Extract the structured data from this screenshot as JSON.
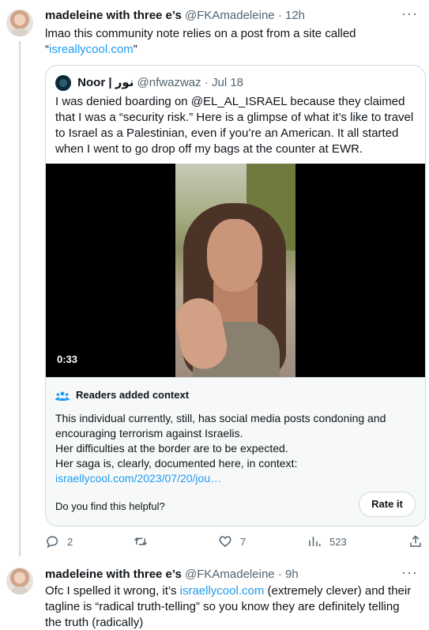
{
  "tweet1": {
    "name": "madeleine with three e’s",
    "handle": "@FKAmadeleine",
    "separator": "·",
    "time": "12h",
    "text_prefix": "lmao this community note relies on a post from a site called “",
    "text_link": "isreallycool.com",
    "text_suffix": "”",
    "quote": {
      "name": "Noor | نور",
      "handle": "@nfwazwaz",
      "separator": "·",
      "date": "Jul 18",
      "text": "I was denied boarding on @EL_AL_ISRAEL because they claimed that I was a “security risk.” Here is a glimpse of what it’s like to travel to Israel as a Palestinian, even if you’re an American. It all started when I went to go drop off my bags at the counter at EWR.",
      "video_duration": "0:33",
      "context": {
        "heading": "Readers added context",
        "line1": "This individual currently, still, has social media posts condoning and encouraging terrorism against Israelis.",
        "line2": "Her difficulties at the border are to be expected.",
        "line3": "Her saga is, clearly, documented here, in context:",
        "link": "israellycool.com/2023/07/20/jou…",
        "helpful_prompt": "Do you find this helpful?",
        "rate_button": "Rate it"
      }
    },
    "actions": {
      "replies": "2",
      "retweets": "",
      "likes": "7",
      "views": "523"
    }
  },
  "tweet2": {
    "name": "madeleine with three e’s",
    "handle": "@FKAmadeleine",
    "separator": "·",
    "time": "9h",
    "text_prefix": "Ofc I spelled it wrong, it’s ",
    "text_link": "israellycool.com",
    "text_suffix": " (extremely clever) and their tagline is “radical truth-telling” so you know they are definitely telling the truth (radically)"
  },
  "colors": {
    "link": "#1d9bf0",
    "secondary_text": "#536471",
    "border": "#cfd9de",
    "context_bg": "#f7f9f9"
  },
  "icons": {
    "more": "more-dots-icon",
    "reply": "reply-icon",
    "retweet": "retweet-icon",
    "like": "heart-icon",
    "views": "views-icon",
    "share": "share-icon",
    "context": "readers-context-icon"
  }
}
